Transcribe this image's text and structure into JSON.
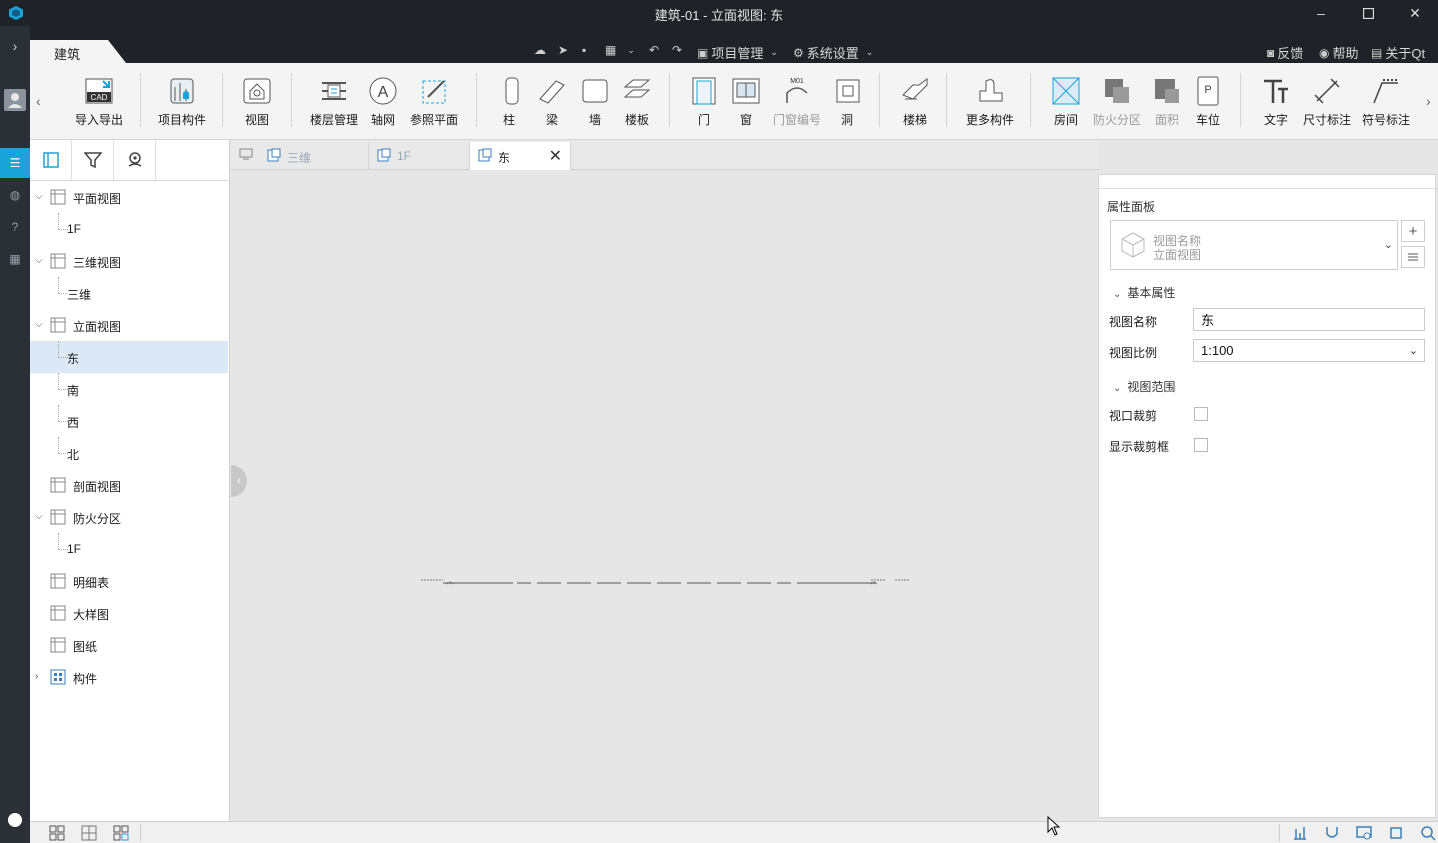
{
  "window": {
    "title": "建筑-01 - 立面视图: 东",
    "minimize": "–",
    "maximize": "☐",
    "close": "✕"
  },
  "menubar": {
    "ribbon_tab": "建筑",
    "project_menu": "项目管理",
    "settings_menu": "系统设置",
    "feedback": "反馈",
    "help": "帮助",
    "about": "关于Qt"
  },
  "ribbon": {
    "import_export": "导入导出",
    "project_component": "项目构件",
    "view": "视图",
    "floor_mgmt": "楼层管理",
    "grid": "轴网",
    "ref_plane": "参照平面",
    "column": "柱",
    "beam": "梁",
    "wall": "墙",
    "slab": "楼板",
    "door": "门",
    "window": "窗",
    "door_window_tag": "门窗编号",
    "opening": "洞",
    "stair": "楼梯",
    "more_components": "更多构件",
    "room": "房间",
    "fire_zone": "防火分区",
    "area": "面积",
    "parking": "车位",
    "text": "文字",
    "dimension": "尺寸标注",
    "symbol": "符号标注",
    "cad_badge": "CAD",
    "tag_badge": "M01",
    "parking_badge": "P"
  },
  "tree": {
    "items": [
      {
        "label": "平面视图",
        "level": 0,
        "expanded": true
      },
      {
        "label": "1F",
        "level": 1
      },
      {
        "label": "三维视图",
        "level": 0,
        "expanded": true
      },
      {
        "label": "三维",
        "level": 1
      },
      {
        "label": "立面视图",
        "level": 0,
        "expanded": true
      },
      {
        "label": "东",
        "level": 1,
        "selected": true
      },
      {
        "label": "南",
        "level": 1
      },
      {
        "label": "西",
        "level": 1
      },
      {
        "label": "北",
        "level": 1
      },
      {
        "label": "剖面视图",
        "level": 0
      },
      {
        "label": "防火分区",
        "level": 0,
        "expanded": true
      },
      {
        "label": "1F",
        "level": 1
      },
      {
        "label": "明细表",
        "level": 0
      },
      {
        "label": "大样图",
        "level": 0
      },
      {
        "label": "图纸",
        "level": 0
      },
      {
        "label": "构件",
        "level": 0,
        "collapsed": true
      }
    ]
  },
  "doc_tabs": [
    {
      "label": "三维"
    },
    {
      "label": "1F"
    },
    {
      "label": "东",
      "active": true
    }
  ],
  "properties": {
    "title": "属性面板",
    "selector_line1": "视图名称",
    "selector_line2": "立面视图",
    "section_basic": "基本属性",
    "view_name_label": "视图名称",
    "view_name_value": "东",
    "view_scale_label": "视图比例",
    "view_scale_value": "1:100",
    "section_range": "视图范围",
    "viewport_crop_label": "视口裁剪",
    "show_crop_label": "显示裁剪框"
  },
  "colors": {
    "accent": "#1aa3d9",
    "selection": "#dbe8f6",
    "titlebar": "#1f2227"
  }
}
